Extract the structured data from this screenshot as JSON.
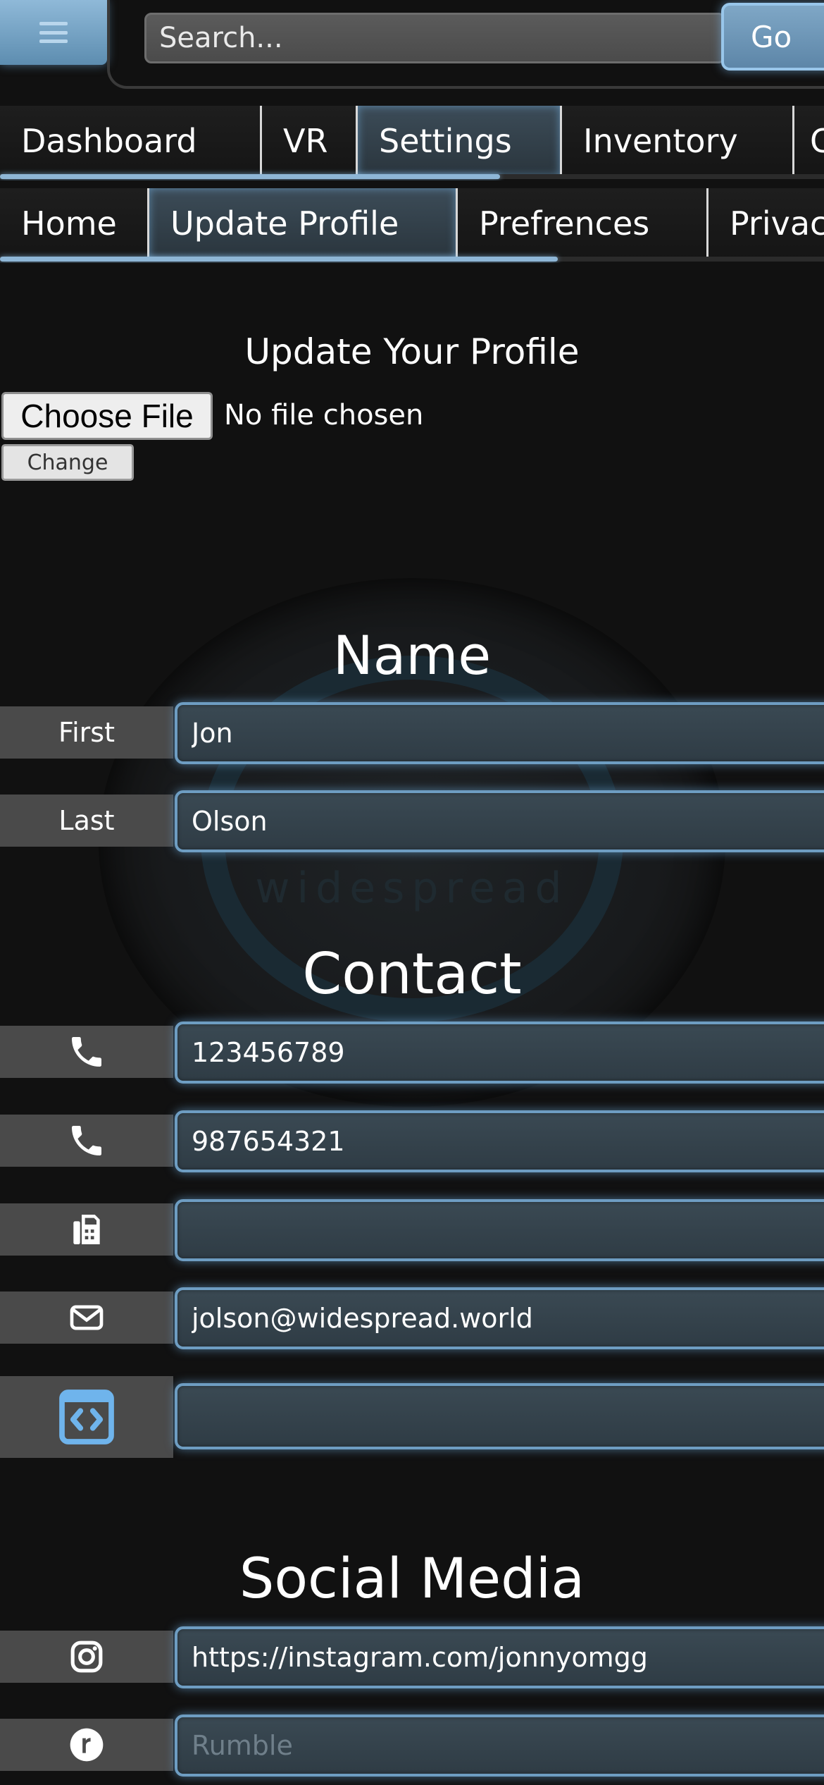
{
  "topbar": {
    "menu_icon": "hamburger-icon",
    "search_placeholder": "Search...",
    "go_label": "Go"
  },
  "main_tabs": [
    {
      "label": "Dashboard",
      "active": false
    },
    {
      "label": "VR",
      "active": false
    },
    {
      "label": "Settings",
      "active": true
    },
    {
      "label": "Inventory",
      "active": false
    },
    {
      "label": "C",
      "active": false
    }
  ],
  "sub_tabs": [
    {
      "label": "Home",
      "active": false
    },
    {
      "label": "Update Profile",
      "active": true
    },
    {
      "label": "Prefrences",
      "active": false
    },
    {
      "label": "Privac",
      "active": false
    }
  ],
  "profile": {
    "title": "Update Your Profile",
    "choose_file_label": "Choose File",
    "file_status": "No file chosen",
    "change_label": "Change",
    "watermark_text": "widespread"
  },
  "name_section": {
    "title": "Name",
    "fields": [
      {
        "label": "First",
        "value": "Jon"
      },
      {
        "label": "Last",
        "value": "Olson"
      }
    ]
  },
  "contact_section": {
    "title": "Contact",
    "fields": [
      {
        "icon": "phone-icon",
        "value": "123456789",
        "placeholder": ""
      },
      {
        "icon": "phone-icon",
        "value": "987654321",
        "placeholder": ""
      },
      {
        "icon": "fax-icon",
        "value": "",
        "placeholder": ""
      },
      {
        "icon": "envelope-icon",
        "value": "jolson@widespread.world",
        "placeholder": ""
      },
      {
        "icon": "code-icon",
        "value": "",
        "placeholder": ""
      }
    ]
  },
  "social_section": {
    "title": "Social Media",
    "fields": [
      {
        "icon": "instagram-icon",
        "value": "https://instagram.com/jonnyomgg",
        "placeholder": ""
      },
      {
        "icon": "rumble-icon",
        "value": "",
        "placeholder": "Rumble"
      }
    ]
  },
  "colors": {
    "background": "#111111",
    "accent": "#6e9dc2",
    "field_bg": "#34434d",
    "label_bg": "#4a4a4a"
  }
}
